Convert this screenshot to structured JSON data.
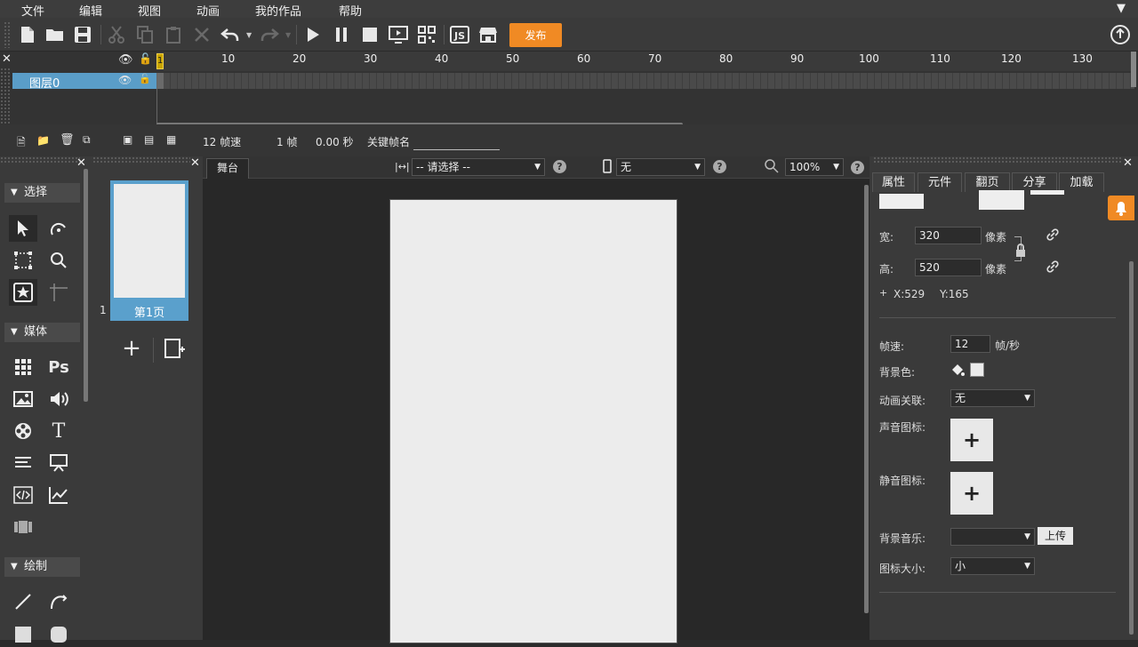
{
  "menu": [
    "文件",
    "编辑",
    "视图",
    "动画",
    "我的作品",
    "帮助"
  ],
  "toolbar": {
    "publish_label": "发布",
    "icons": [
      "new-file",
      "open-folder",
      "save",
      "cut",
      "copy",
      "paste",
      "delete",
      "undo",
      "redo",
      "play",
      "pause",
      "stop",
      "preview",
      "qrcode",
      "js",
      "store",
      "upload"
    ]
  },
  "timeline": {
    "ticks": [
      "10",
      "20",
      "30",
      "40",
      "50",
      "60",
      "70",
      "80",
      "90",
      "100",
      "110",
      "120",
      "130"
    ],
    "layer_name": "图层0",
    "current_frame_marker": "1",
    "status": {
      "fps": "12 帧速",
      "frame": "1 帧",
      "time": "0.00 秒",
      "keyframe_label": "关键帧名"
    }
  },
  "tools": {
    "select_header": "选择",
    "media_header": "媒体",
    "draw_header": "绘制",
    "ps_label": "Ps",
    "text_label": "T"
  },
  "pages": {
    "page_number": "1",
    "page_label": "第1页"
  },
  "stage": {
    "tab_label": "舞台",
    "select_placeholder": "-- 请选择 --",
    "device_value": "无",
    "zoom_value": "100%",
    "help_icon": "?"
  },
  "props": {
    "tabs": [
      "属性",
      "元件",
      "翻页",
      "分享",
      "加载"
    ],
    "width_label": "宽:",
    "width_value": "320",
    "height_label": "高:",
    "height_value": "520",
    "unit": "像素",
    "coords_x": "X:529",
    "coords_y": "Y:165",
    "fps_label": "帧速:",
    "fps_value": "12",
    "fps_unit": "帧/秒",
    "bgcolor_label": "背景色:",
    "anim_link_label": "动画关联:",
    "anim_link_value": "无",
    "sound_icon_label": "声音图标:",
    "mute_icon_label": "静音图标:",
    "bg_music_label": "背景音乐:",
    "upload_label": "上传",
    "icon_size_label": "图标大小:",
    "icon_size_value": "小",
    "plus": "+"
  },
  "colors": {
    "accent": "#f08a24",
    "layer_selected": "#5a9dc8",
    "page_selected": "#5aa0cc",
    "stage_bg": "#ececec"
  }
}
